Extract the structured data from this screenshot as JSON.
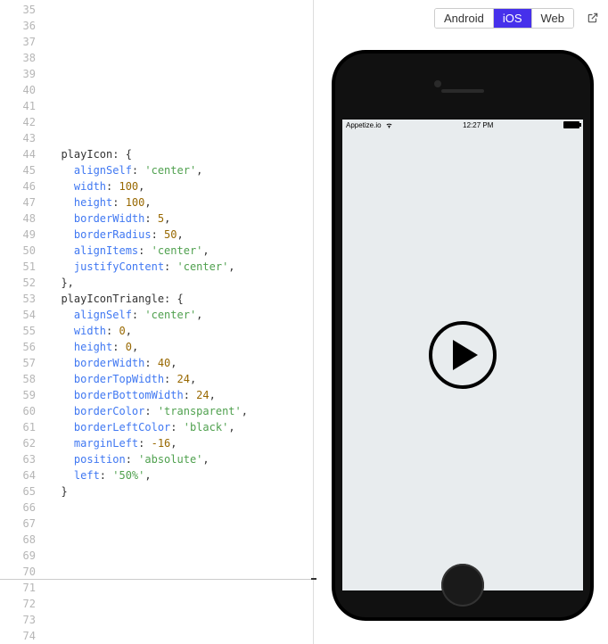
{
  "gutter": {
    "start": 35,
    "end": 74
  },
  "code_lines": [
    [],
    [],
    [],
    [],
    [],
    [],
    [],
    [],
    [],
    [
      {
        "t": "ident",
        "v": "  playIcon"
      },
      {
        "t": "punct",
        "v": ": {"
      }
    ],
    [
      {
        "t": "key",
        "v": "    alignSelf"
      },
      {
        "t": "punct",
        "v": ": "
      },
      {
        "t": "str",
        "v": "'center'"
      },
      {
        "t": "punct",
        "v": ","
      }
    ],
    [
      {
        "t": "key",
        "v": "    width"
      },
      {
        "t": "punct",
        "v": ": "
      },
      {
        "t": "num",
        "v": "100"
      },
      {
        "t": "punct",
        "v": ","
      }
    ],
    [
      {
        "t": "key",
        "v": "    height"
      },
      {
        "t": "punct",
        "v": ": "
      },
      {
        "t": "num",
        "v": "100"
      },
      {
        "t": "punct",
        "v": ","
      }
    ],
    [
      {
        "t": "key",
        "v": "    borderWidth"
      },
      {
        "t": "punct",
        "v": ": "
      },
      {
        "t": "num",
        "v": "5"
      },
      {
        "t": "punct",
        "v": ","
      }
    ],
    [
      {
        "t": "key",
        "v": "    borderRadius"
      },
      {
        "t": "punct",
        "v": ": "
      },
      {
        "t": "num",
        "v": "50"
      },
      {
        "t": "punct",
        "v": ","
      }
    ],
    [
      {
        "t": "key",
        "v": "    alignItems"
      },
      {
        "t": "punct",
        "v": ": "
      },
      {
        "t": "str",
        "v": "'center'"
      },
      {
        "t": "punct",
        "v": ","
      }
    ],
    [
      {
        "t": "key",
        "v": "    justifyContent"
      },
      {
        "t": "punct",
        "v": ": "
      },
      {
        "t": "str",
        "v": "'center'"
      },
      {
        "t": "punct",
        "v": ","
      }
    ],
    [
      {
        "t": "punct",
        "v": "  },"
      }
    ],
    [
      {
        "t": "ident",
        "v": "  playIconTriangle"
      },
      {
        "t": "punct",
        "v": ": {"
      }
    ],
    [
      {
        "t": "key",
        "v": "    alignSelf"
      },
      {
        "t": "punct",
        "v": ": "
      },
      {
        "t": "str",
        "v": "'center'"
      },
      {
        "t": "punct",
        "v": ","
      }
    ],
    [
      {
        "t": "key",
        "v": "    width"
      },
      {
        "t": "punct",
        "v": ": "
      },
      {
        "t": "num",
        "v": "0"
      },
      {
        "t": "punct",
        "v": ","
      }
    ],
    [
      {
        "t": "key",
        "v": "    height"
      },
      {
        "t": "punct",
        "v": ": "
      },
      {
        "t": "num",
        "v": "0"
      },
      {
        "t": "punct",
        "v": ","
      }
    ],
    [
      {
        "t": "key",
        "v": "    borderWidth"
      },
      {
        "t": "punct",
        "v": ": "
      },
      {
        "t": "num",
        "v": "40"
      },
      {
        "t": "punct",
        "v": ","
      }
    ],
    [
      {
        "t": "key",
        "v": "    borderTopWidth"
      },
      {
        "t": "punct",
        "v": ": "
      },
      {
        "t": "num",
        "v": "24"
      },
      {
        "t": "punct",
        "v": ","
      }
    ],
    [
      {
        "t": "key",
        "v": "    borderBottomWidth"
      },
      {
        "t": "punct",
        "v": ": "
      },
      {
        "t": "num",
        "v": "24"
      },
      {
        "t": "punct",
        "v": ","
      }
    ],
    [
      {
        "t": "key",
        "v": "    borderColor"
      },
      {
        "t": "punct",
        "v": ": "
      },
      {
        "t": "str",
        "v": "'transparent'"
      },
      {
        "t": "punct",
        "v": ","
      }
    ],
    [
      {
        "t": "key",
        "v": "    borderLeftColor"
      },
      {
        "t": "punct",
        "v": ": "
      },
      {
        "t": "str",
        "v": "'black'"
      },
      {
        "t": "punct",
        "v": ","
      }
    ],
    [
      {
        "t": "key",
        "v": "    marginLeft"
      },
      {
        "t": "punct",
        "v": ": "
      },
      {
        "t": "num",
        "v": "-16"
      },
      {
        "t": "punct",
        "v": ","
      }
    ],
    [
      {
        "t": "key",
        "v": "    position"
      },
      {
        "t": "punct",
        "v": ": "
      },
      {
        "t": "str",
        "v": "'absolute'"
      },
      {
        "t": "punct",
        "v": ","
      }
    ],
    [
      {
        "t": "key",
        "v": "    left"
      },
      {
        "t": "punct",
        "v": ": "
      },
      {
        "t": "str",
        "v": "'50%'"
      },
      {
        "t": "punct",
        "v": ","
      }
    ],
    [
      {
        "t": "punct",
        "v": "  }"
      }
    ],
    [],
    [],
    [],
    [],
    [],
    [],
    [],
    [],
    []
  ],
  "platforms": [
    {
      "label": "Android",
      "active": false
    },
    {
      "label": "iOS",
      "active": true
    },
    {
      "label": "Web",
      "active": false
    }
  ],
  "status": {
    "brand": "Appetize.io",
    "time": "12:27 PM"
  }
}
